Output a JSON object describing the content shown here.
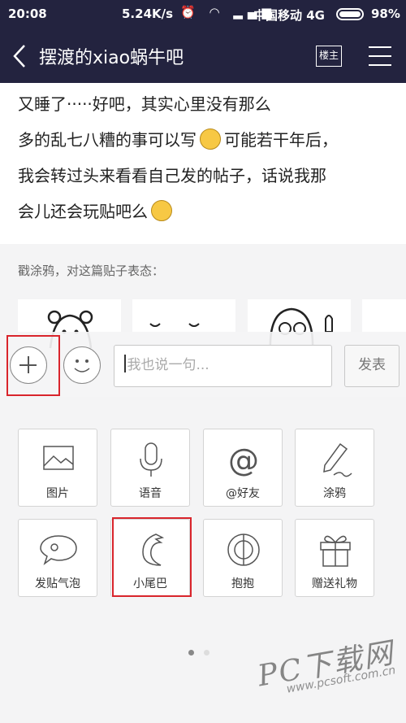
{
  "status_bar": {
    "time": "20:08",
    "net_speed": "5.24K/s",
    "carrier": "中国移动 4G",
    "battery": "98%",
    "battery_level": 0.98
  },
  "nav": {
    "title": "摆渡的xiao蜗牛吧",
    "owner_badge": "楼主"
  },
  "post": {
    "line1": "又睡了·····好吧，其实心里没有那么",
    "line2a": "多的乱七八糟的事可以写",
    "line2b": "可能若干年后，",
    "line3": "我会转过头来看看自己发的帖子，话说我那",
    "line4": "会儿还会玩贴吧么"
  },
  "stance_prompt": "戳涂鸦，对这篇贴子表态：",
  "reply": {
    "placeholder": "我也说一句...",
    "send_label": "发表"
  },
  "tools": [
    {
      "label": "图片",
      "icon": "image-icon"
    },
    {
      "label": "语音",
      "icon": "microphone-icon"
    },
    {
      "label": "@好友",
      "icon": "at-icon"
    },
    {
      "label": "涂鸦",
      "icon": "pen-icon"
    },
    {
      "label": "发贴气泡",
      "icon": "bubble-icon"
    },
    {
      "label": "小尾巴",
      "icon": "tail-icon"
    },
    {
      "label": "抱抱",
      "icon": "hug-icon"
    },
    {
      "label": "赠送礼物",
      "icon": "gift-icon"
    }
  ],
  "watermark": {
    "main": "PC下载网",
    "sub": "www.pcsoft.com.cn"
  }
}
